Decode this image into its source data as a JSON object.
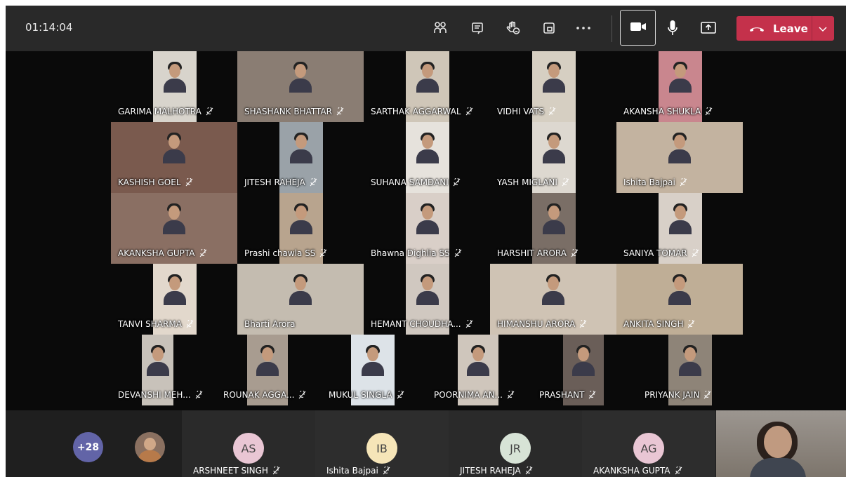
{
  "meeting": {
    "timer": "01:14:04",
    "leave_label": "Leave",
    "toolbar_icons": [
      "participants-icon",
      "chat-icon",
      "raise-hand-icon",
      "rooms-icon",
      "more-actions-icon",
      "camera-icon",
      "microphone-icon",
      "share-screen-icon"
    ]
  },
  "grid": {
    "rows": [
      [
        {
          "name": "GARIMA MALHOTRA"
        },
        {
          "name": "SHASHANK BHATTAR"
        },
        {
          "name": "SARTHAK AGGARWAL"
        },
        {
          "name": "VIDHI VATS"
        },
        {
          "name": "AKANSHA SHUKLA"
        }
      ],
      [
        {
          "name": "KASHISH GOEL"
        },
        {
          "name": "JITESH RAHEJA"
        },
        {
          "name": "SUHANA SAMDANI"
        },
        {
          "name": "YASH MIGLANI"
        },
        {
          "name": "Ishita Bajpai"
        }
      ],
      [
        {
          "name": "AKANKSHA GUPTA"
        },
        {
          "name": "Prashi chawla SS"
        },
        {
          "name": "Bhawna Dighlia SS"
        },
        {
          "name": "HARSHIT ARORA"
        },
        {
          "name": "SANIYA TOMAR"
        }
      ],
      [
        {
          "name": "TANVI SHARMA"
        },
        {
          "name": "Bharti Arora"
        },
        {
          "name": "HEMANT CHOUDHA..."
        },
        {
          "name": "HIMANSHU ARORA"
        },
        {
          "name": "ANKITA SINGH"
        }
      ],
      [
        {
          "name": "DEVANSHI MEH..."
        },
        {
          "name": "ROUNAK AGGA..."
        },
        {
          "name": "MUKUL SINGLA"
        },
        {
          "name": "POORNIMA AN..."
        },
        {
          "name": "PRASHANT"
        },
        {
          "name": "PRIYANK JAIN"
        }
      ]
    ]
  },
  "strip": {
    "overflow_count": "+28",
    "cards": [
      {
        "initials": "AS",
        "name": "ARSHNEET SINGH",
        "color": "#e9c6d4"
      },
      {
        "initials": "IB",
        "name": "Ishita Bajpai",
        "color": "#f6e5b8"
      },
      {
        "initials": "JR",
        "name": "JITESH RAHEJA",
        "color": "#d7e3d6"
      },
      {
        "initials": "AG",
        "name": "AKANKSHA GUPTA",
        "color": "#e9c6d4"
      }
    ]
  },
  "colors": {
    "leave": "#c4314b",
    "topbar": "#292929",
    "overflow_badge": "#6264a7"
  }
}
